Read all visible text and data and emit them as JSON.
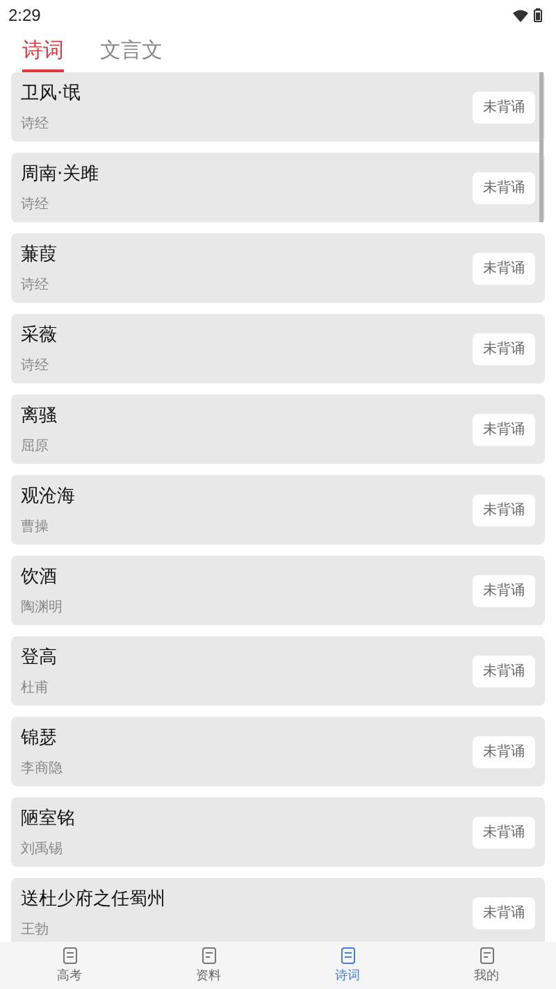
{
  "status_bar": {
    "time": "2:29"
  },
  "tabs": [
    {
      "label": "诗词",
      "selected": true
    },
    {
      "label": "文言文",
      "selected": false
    }
  ],
  "poems": [
    {
      "title": "卫风·氓",
      "author": "诗经",
      "button": "未背诵"
    },
    {
      "title": "周南·关雎",
      "author": "诗经",
      "button": "未背诵"
    },
    {
      "title": "蒹葭",
      "author": "诗经",
      "button": "未背诵"
    },
    {
      "title": "采薇",
      "author": "诗经",
      "button": "未背诵"
    },
    {
      "title": "离骚",
      "author": "屈原",
      "button": "未背诵"
    },
    {
      "title": "观沧海",
      "author": "曹操",
      "button": "未背诵"
    },
    {
      "title": "饮酒",
      "author": "陶渊明",
      "button": "未背诵"
    },
    {
      "title": "登高",
      "author": "杜甫",
      "button": "未背诵"
    },
    {
      "title": "锦瑟",
      "author": "李商隐",
      "button": "未背诵"
    },
    {
      "title": "陋室铭",
      "author": "刘禹锡",
      "button": "未背诵"
    },
    {
      "title": "送杜少府之任蜀州",
      "author": "王勃",
      "button": "未背诵"
    }
  ],
  "bottom_nav": [
    {
      "label": "高考",
      "selected": false
    },
    {
      "label": "资料",
      "selected": false
    },
    {
      "label": "诗词",
      "selected": true
    },
    {
      "label": "我的",
      "selected": false
    }
  ]
}
